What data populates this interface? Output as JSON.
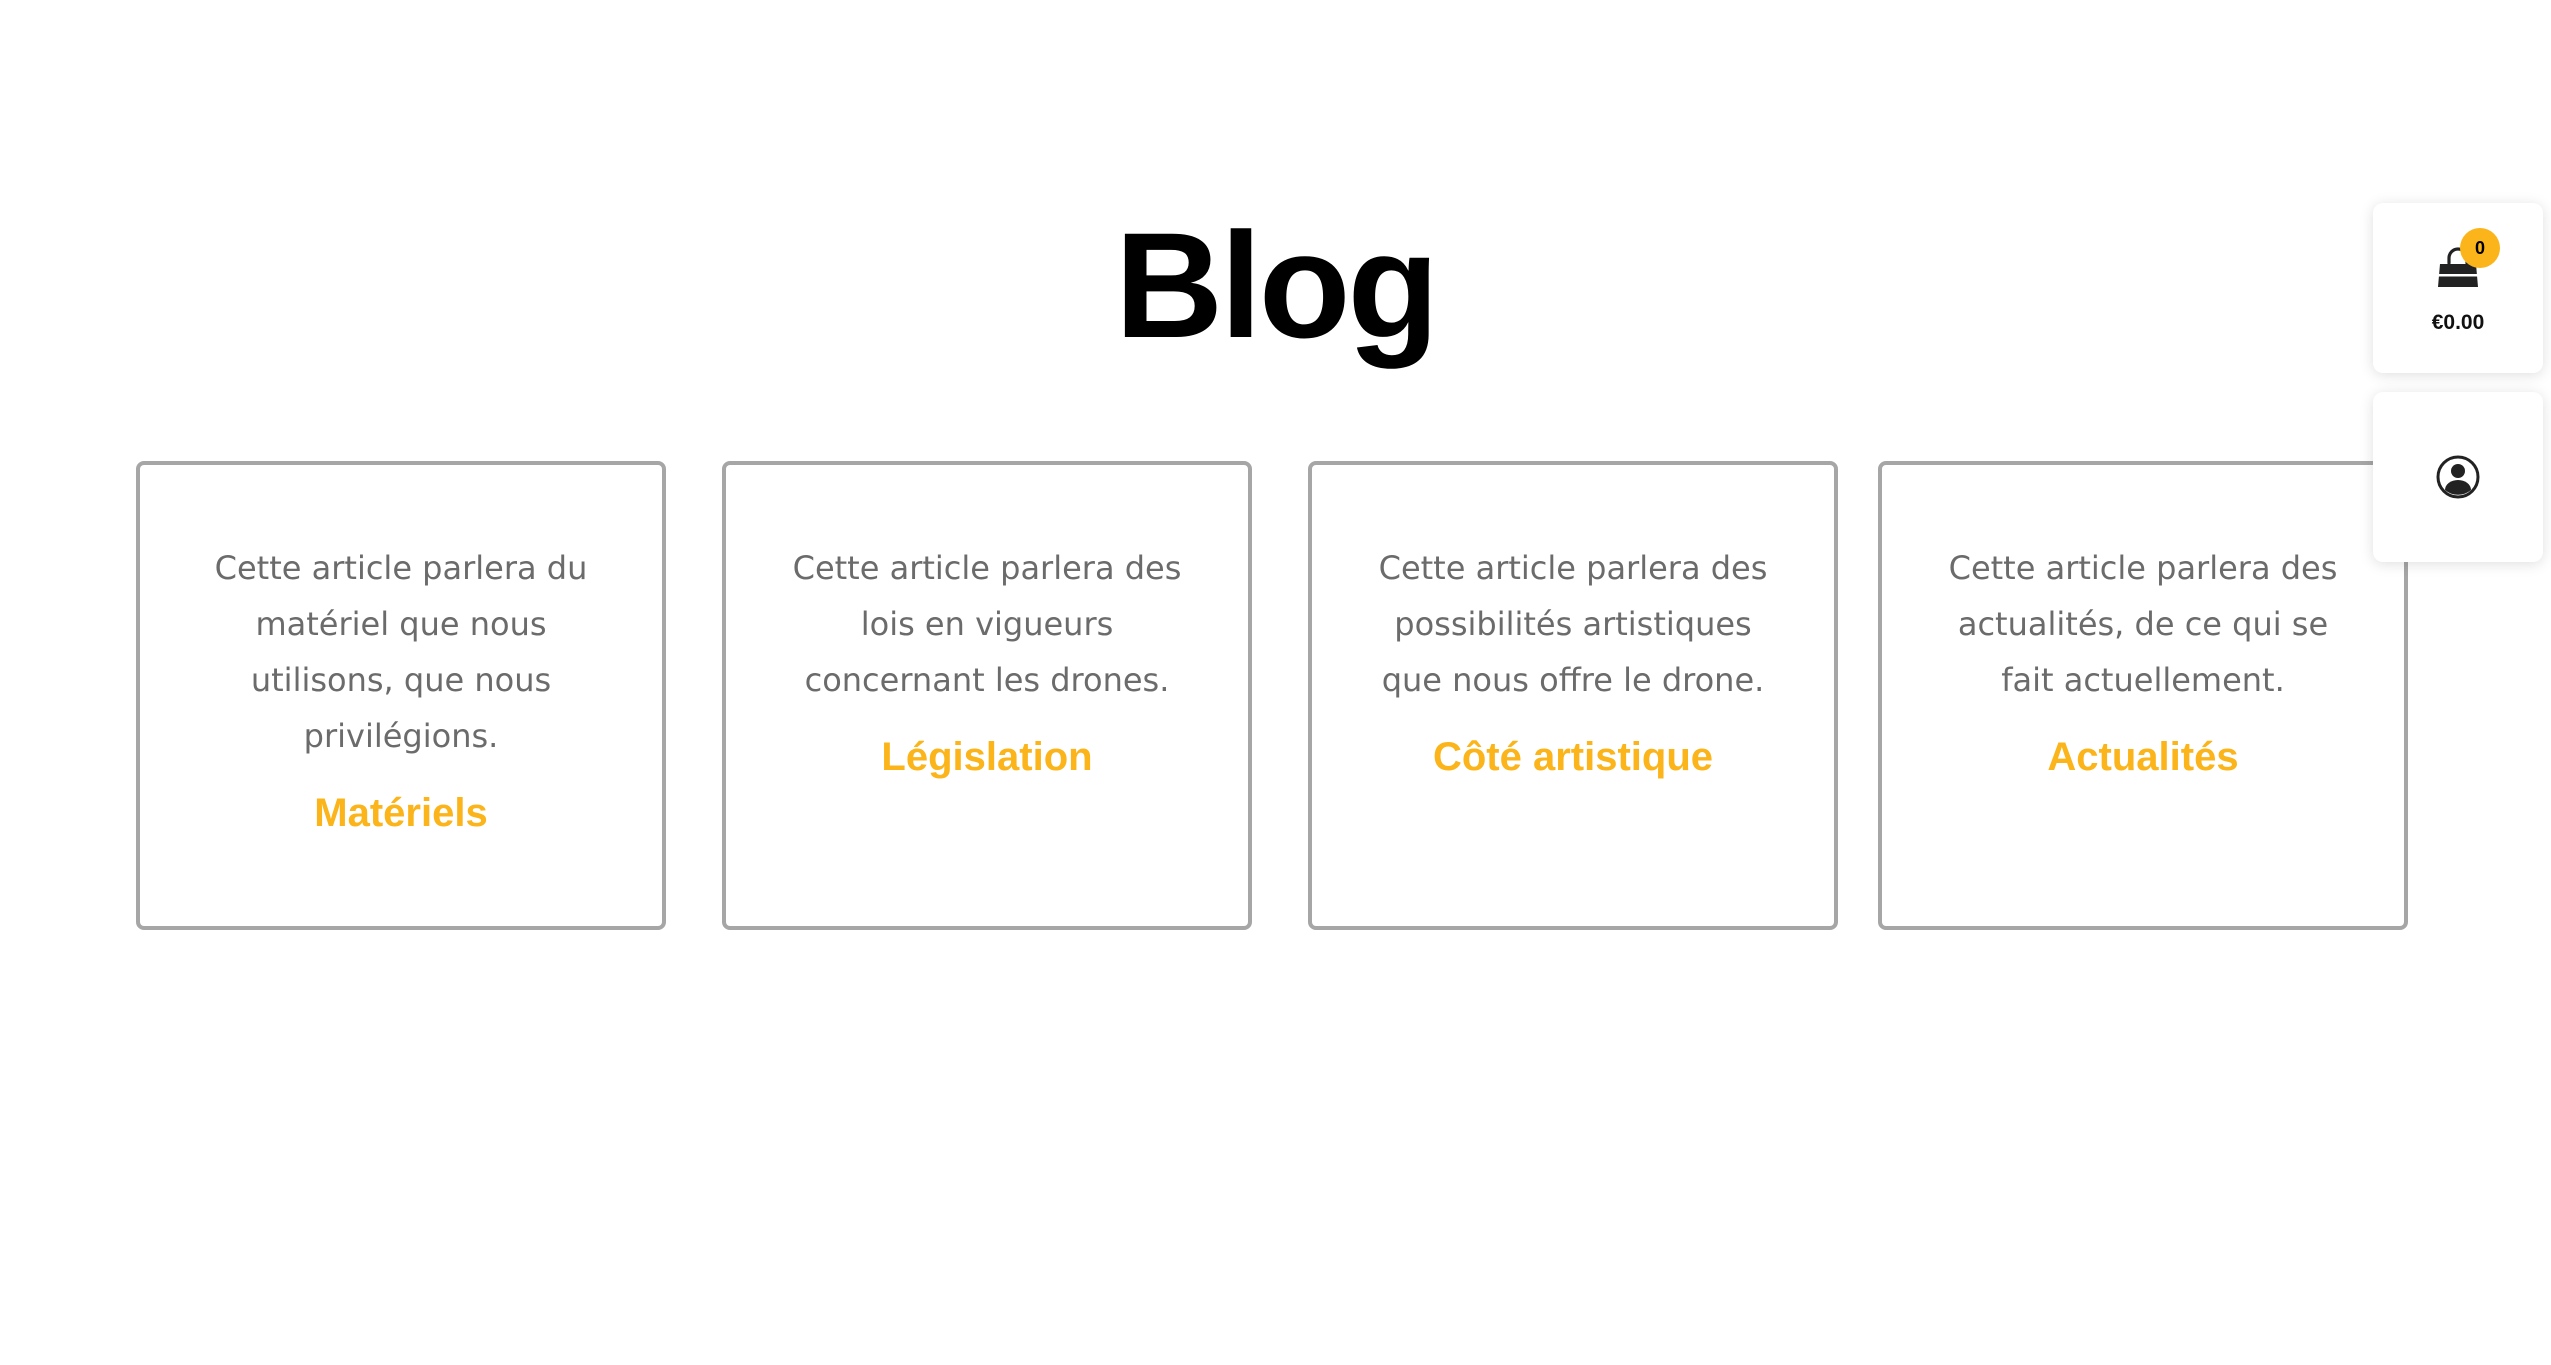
{
  "page": {
    "title": "Blog"
  },
  "articles": [
    {
      "excerpt": "Cette article parlera du matériel que nous utilisons, que nous privilégions.",
      "link_label": "Matériels"
    },
    {
      "excerpt": "Cette article parlera des lois en vigueurs concernant les drones.",
      "link_label": "Législation"
    },
    {
      "excerpt": "Cette article parlera des possibilités artistiques que nous offre le drone.",
      "link_label": "Côté artistique"
    },
    {
      "excerpt": "Cette article parlera des actualités, de ce qui se fait actuellement.",
      "link_label": "Actualités"
    }
  ],
  "cart": {
    "count": "0",
    "total": "€0.00",
    "icon": "shopping-bag-icon"
  },
  "account": {
    "icon": "user-circle-icon"
  },
  "colors": {
    "accent": "#fbb41a",
    "card_border": "#a6a6a6",
    "body_text": "#6b6b6b",
    "title": "#000000"
  }
}
